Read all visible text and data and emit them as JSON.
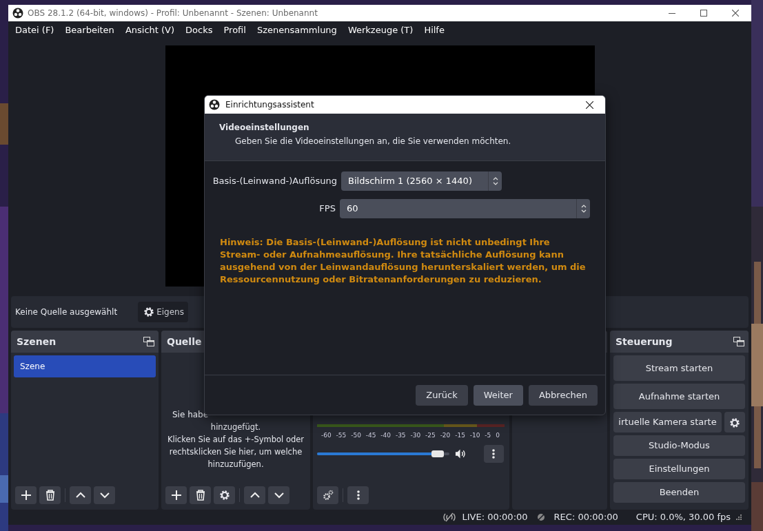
{
  "window": {
    "title": "OBS 28.1.2 (64-bit, windows) - Profil: Unbenannt - Szenen: Unbenannt"
  },
  "menu": [
    "Datei (F)",
    "Bearbeiten",
    "Ansicht (V)",
    "Docks",
    "Profil",
    "Szenensammlung",
    "Werkzeuge (T)",
    "Hilfe"
  ],
  "context_bar": {
    "label": "Keine Quelle ausgewählt",
    "properties_button": "Eigens"
  },
  "scenes_dock": {
    "title": "Szenen",
    "items": [
      {
        "label": "Szene",
        "selected": true
      }
    ]
  },
  "sources_dock": {
    "title": "Quelle",
    "cut_line": "Sie habe",
    "message_lines": [
      "hinzugefügt.",
      "Klicken Sie auf das +-Symbol oder",
      "rechtsklicken Sie hier, um welche",
      "hinzuzufügen."
    ]
  },
  "audio_mixer": {
    "meter_ticks": [
      "-60",
      "-55",
      "-50",
      "-45",
      "-40",
      "-35",
      "-30",
      "-25",
      "-20",
      "-15",
      "-10",
      "-5",
      "0"
    ],
    "volume": {
      "level": 0.96
    }
  },
  "controls_dock": {
    "title": "Steuerung",
    "buttons": [
      {
        "label": "Stream starten",
        "kind": "plain"
      },
      {
        "label": "Aufnahme starten",
        "kind": "plain"
      },
      {
        "label": "irtuelle Kamera starte",
        "kind": "with-gear"
      },
      {
        "label": "Studio-Modus",
        "kind": "plain"
      },
      {
        "label": "Einstellungen",
        "kind": "plain"
      },
      {
        "label": "Beenden",
        "kind": "plain"
      }
    ]
  },
  "status_bar": {
    "live": "LIVE: 00:00:00",
    "rec": "REC: 00:00:00",
    "cpu": "CPU: 0.0%, 30.00 fps"
  },
  "dialog": {
    "title": "Einrichtungsassistent",
    "heading": "Videoeinstellungen",
    "subheading": "Geben Sie die Videoeinstellungen an, die Sie verwenden möchten.",
    "fields": [
      {
        "label": "Basis-(Leinwand-)Auflösung",
        "value": "Bildschirm 1 (2560 × 1440)"
      },
      {
        "label": "FPS",
        "value": "60"
      }
    ],
    "hint": "Hinweis: Die Basis-(Leinwand-)Auflösung ist nicht unbedingt Ihre Stream- oder Aufnahmeauflösung. Ihre tatsächliche Auflösung kann ausgehend von der Leinwandauflösung herunterskaliert werden, um die Ressourcennutzung oder Bitratenanforderungen zu reduzieren.",
    "buttons": [
      {
        "label": "Zurück",
        "selected": false
      },
      {
        "label": "Weiter",
        "selected": true
      },
      {
        "label": "Abbrechen",
        "selected": false
      }
    ]
  }
}
